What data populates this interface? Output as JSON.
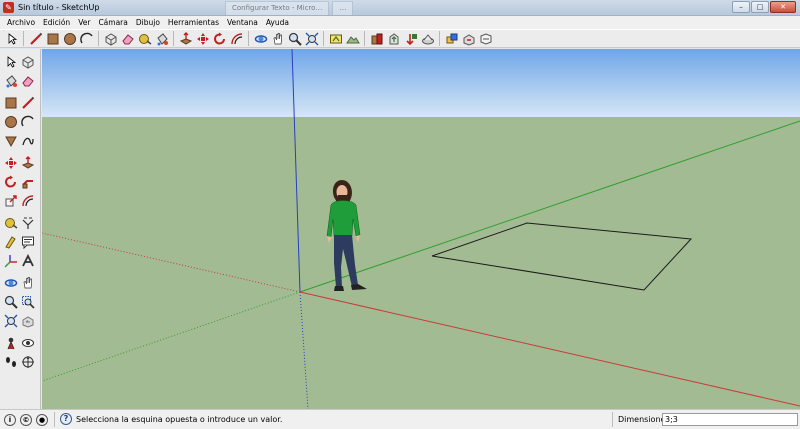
{
  "window": {
    "title": "Sin título - SketchUp",
    "background_tabs": [
      "Configurar Texto - Micro…",
      "…"
    ],
    "controls": {
      "minimize": "–",
      "maximize": "□",
      "close": "✕"
    }
  },
  "menu": [
    "Archivo",
    "Edición",
    "Ver",
    "Cámara",
    "Dibujo",
    "Herramientas",
    "Ventana",
    "Ayuda"
  ],
  "toolbar_icons": [
    "select-icon",
    "line-pencil-icon",
    "rectangle-icon",
    "circle-icon",
    "arc-icon",
    "make-component-icon",
    "eraser-icon",
    "tape-measure-icon",
    "paint-bucket-icon",
    "push-pull-icon",
    "move-icon",
    "rotate-icon",
    "offset-icon",
    "orbit-icon",
    "pan-icon",
    "zoom-icon",
    "zoom-extents-icon",
    "add-location-icon",
    "toggle-terrain-icon",
    "get-models-icon",
    "share-model-icon",
    "get-photo-texture-icon",
    "3d-warehouse-icon",
    "share-component-icon",
    "extension-warehouse-icon",
    "send-to-layout-icon"
  ],
  "left_toolbar_icons": [
    [
      "select-icon",
      "make-component-icon"
    ],
    [
      "paint-bucket-icon",
      "eraser-icon"
    ],
    [
      "rectangle-icon",
      "line-pencil-icon"
    ],
    [
      "circle-icon",
      "arc-icon"
    ],
    [
      "polygon-icon",
      "freehand-icon"
    ],
    [
      "move-icon",
      "push-pull-icon"
    ],
    [
      "rotate-icon",
      "follow-me-icon"
    ],
    [
      "scale-icon",
      "offset-icon"
    ],
    [
      "tape-measure-icon",
      "dimension-icon"
    ],
    [
      "protractor-icon",
      "text-icon"
    ],
    [
      "axes-icon",
      "3d-text-icon"
    ],
    [
      "orbit-icon",
      "pan-icon"
    ],
    [
      "zoom-icon",
      "zoom-window-icon"
    ],
    [
      "zoom-extents-icon",
      "previous-view-icon"
    ],
    [
      "position-camera-icon",
      "look-around-icon"
    ],
    [
      "walk-icon",
      "section-plane-icon"
    ]
  ],
  "status": {
    "message": "Selecciona la esquina opuesta o introduce un valor.",
    "dimensions_label": "Dimensiones",
    "dimensions_value": "3;3"
  },
  "colors": {
    "sky_top": "#6fa6e8",
    "sky_bottom": "#d6e6f6",
    "ground": "#a3bb93",
    "axis_red": "#c83a3a",
    "axis_green": "#2ea02e",
    "axis_blue": "#2a3fbf",
    "figure_shirt": "#1f9d3a",
    "figure_pants": "#2d3b5f"
  }
}
